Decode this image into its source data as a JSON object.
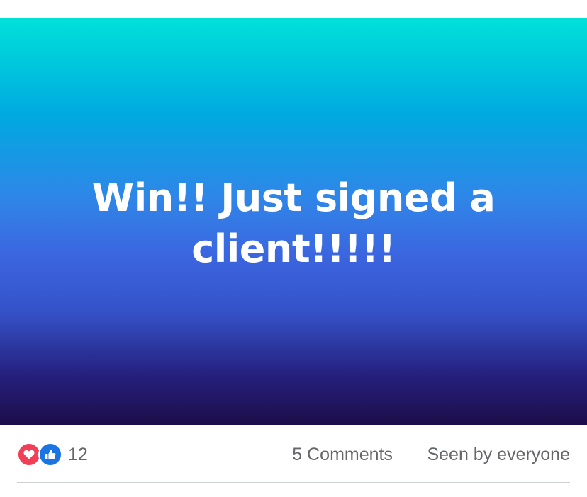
{
  "post": {
    "text": "Win!! Just signed a client!!!!!",
    "gradient_colors": [
      "#00e1d9",
      "#00a9e0",
      "#3b66e0",
      "#251f7c",
      "#1c0d48"
    ]
  },
  "reactions": {
    "icons": [
      "love-icon",
      "like-icon"
    ],
    "count": "12",
    "comments": "5 Comments",
    "seen_by": "Seen by everyone",
    "colors": {
      "love": "#f33e58",
      "like": "#1b74e4",
      "muted_text": "#65676b"
    }
  }
}
